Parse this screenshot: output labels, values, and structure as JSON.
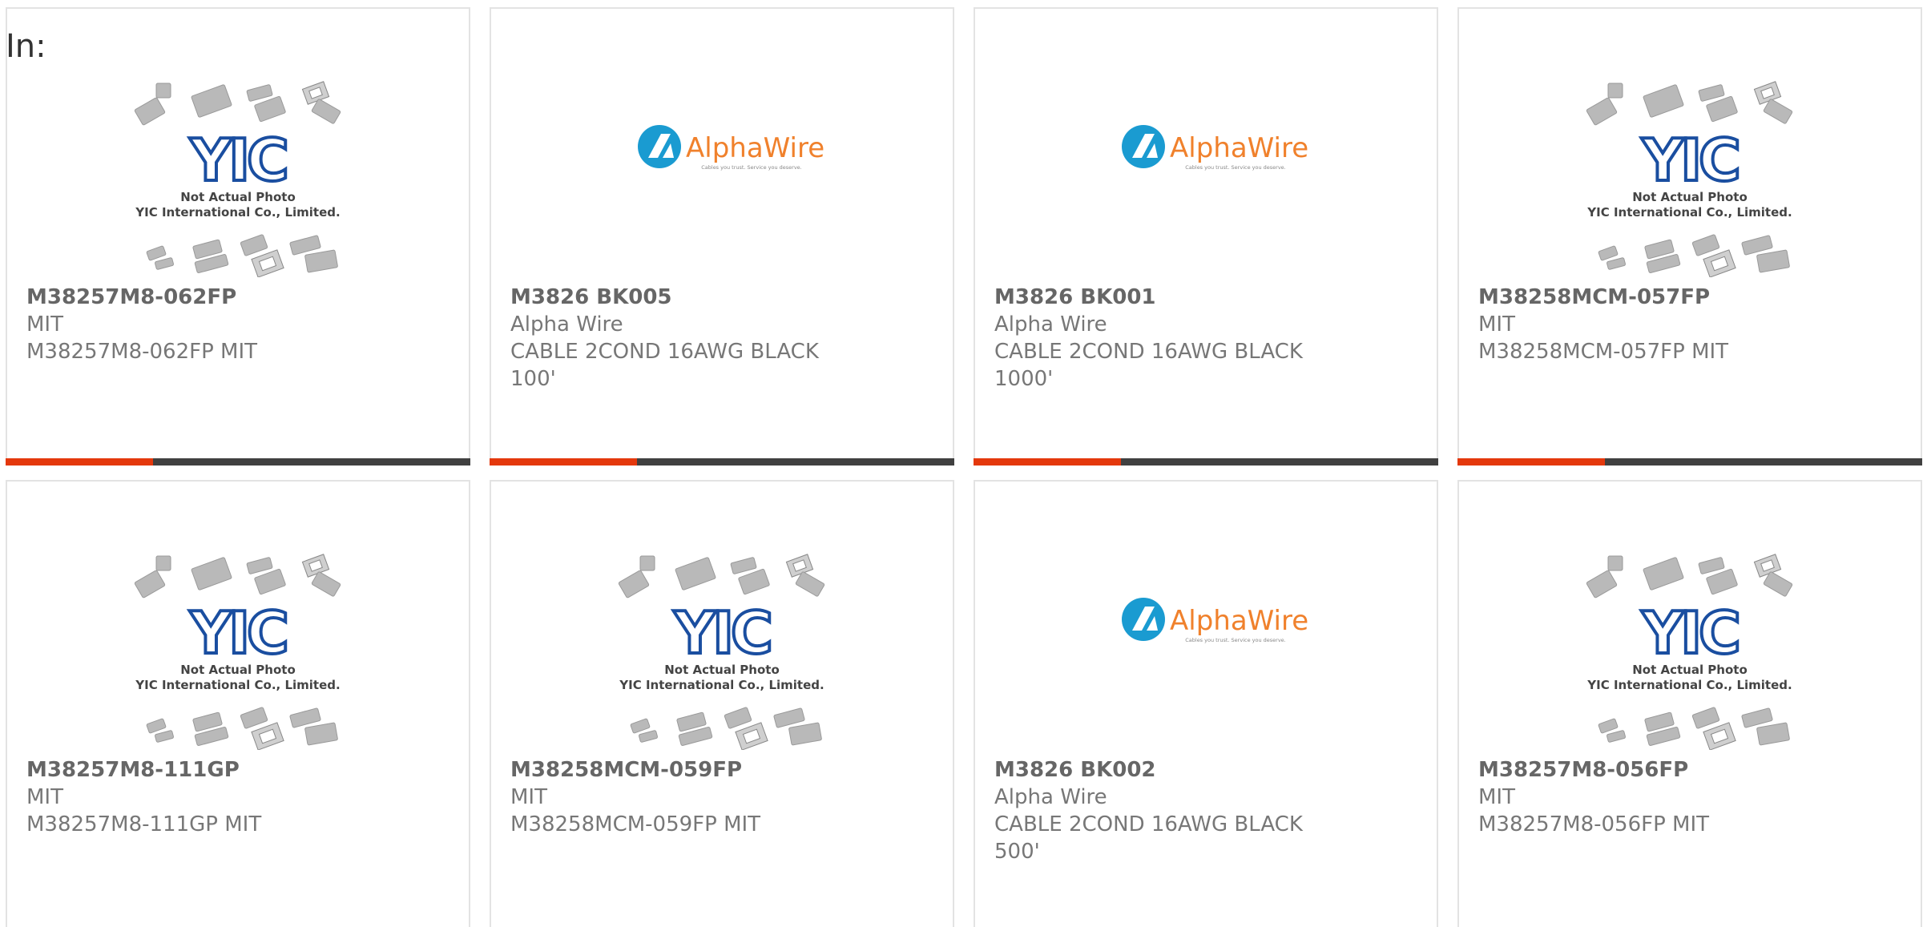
{
  "filter": {
    "label": "In:"
  },
  "colors": {
    "accent_red": "#e4380c",
    "accent_dark": "#404040",
    "alphawire_blue": "#1a9bd1",
    "alphawire_orange": "#f0812c",
    "yic_blue": "#1a4ea0"
  },
  "placeholder": {
    "yic_line1": "Not Actual Photo",
    "yic_line2": "YIC International Co., Limited.",
    "yic_logo": "YIC",
    "alpha_logo": "AlphaWire",
    "alpha_tag": "Cables you trust. Service you deserve."
  },
  "products": [
    {
      "part": "M38257M8-062FP",
      "mfr": "MIT",
      "desc": "M38257M8-062FP MIT",
      "image": "yic"
    },
    {
      "part": "M3826 BK005",
      "mfr": "Alpha Wire",
      "desc": "CABLE 2COND 16AWG BLACK 100'",
      "image": "alphawire"
    },
    {
      "part": "M3826 BK001",
      "mfr": "Alpha Wire",
      "desc": "CABLE 2COND 16AWG BLACK 1000'",
      "image": "alphawire"
    },
    {
      "part": "M38258MCM-057FP",
      "mfr": "MIT",
      "desc": "M38258MCM-057FP MIT",
      "image": "yic"
    },
    {
      "part": "M38257M8-111GP",
      "mfr": "MIT",
      "desc": "M38257M8-111GP MIT",
      "image": "yic"
    },
    {
      "part": "M38258MCM-059FP",
      "mfr": "MIT",
      "desc": "M38258MCM-059FP MIT",
      "image": "yic"
    },
    {
      "part": "M3826 BK002",
      "mfr": "Alpha Wire",
      "desc": "CABLE 2COND 16AWG BLACK 500'",
      "image": "alphawire"
    },
    {
      "part": "M38257M8-056FP",
      "mfr": "MIT",
      "desc": "M38257M8-056FP MIT",
      "image": "yic"
    }
  ]
}
